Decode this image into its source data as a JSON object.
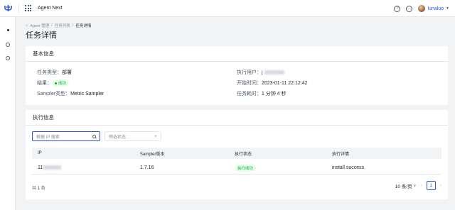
{
  "header": {
    "app_title": "Agent Next",
    "user_name": "lunaluo",
    "help_icon": "question-icon",
    "message_icon": "chat-icon"
  },
  "breadcrumb": {
    "items": [
      "Agent 管理",
      "任务列表",
      "任务详情"
    ]
  },
  "page_title": "任务详情",
  "basic_info": {
    "title": "基本信息",
    "task_type_label": "任务类型：",
    "task_type_value": "部署",
    "exec_user_label": "执行用户：",
    "exec_user_value": "j",
    "result_label": "结果：",
    "result_value": "成功",
    "start_time_label": "开始时间：",
    "start_time_value": "2023-01-11 22:12:42",
    "sampler_type_label": "Sampler类型：",
    "sampler_type_value": "Metric Sampler",
    "duration_label": "任务耗时：",
    "duration_value": "1 分钟 4 秒"
  },
  "exec_info": {
    "title": "执行信息",
    "search_placeholder": "根据 IP 搜索",
    "filter_placeholder": "筛选状态",
    "columns": [
      "IP",
      "Sampler版本",
      "执行状态",
      "执行详情"
    ],
    "rows": [
      {
        "ip": "11",
        "version": "1.7.16",
        "status": "执行成功",
        "detail": "install success."
      }
    ],
    "total_prefix": "共",
    "total_count": "1",
    "total_suffix": "条",
    "page_size": "10 条/页",
    "current_page": "1"
  },
  "colors": {
    "accent": "#2a55e5",
    "success": "#00b42a",
    "success_bg": "#e8ffea",
    "background": "#f2f3f5"
  }
}
